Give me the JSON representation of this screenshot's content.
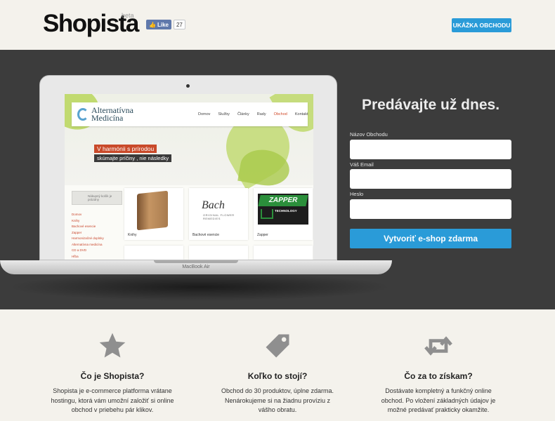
{
  "header": {
    "logo": "Shopista",
    "beta": "beta",
    "like_label": "Like",
    "like_count": "27",
    "demo_button": "UKÁŽKA OBCHODU"
  },
  "laptop": {
    "label": "MacBook Air",
    "site": {
      "name_line1": "Alternatívna",
      "name_line2": "Medicína",
      "nav": [
        "Domov",
        "Služby",
        "Články",
        "Rady",
        "Obchod",
        "Kontakt"
      ],
      "banner_line1": "V harmónii s prírodou",
      "banner_line2": "skúmajte príčiny , nie následky",
      "cart": "Nákupný košík je prázdny",
      "sidebar": [
        "Domov",
        "Knihy",
        "Bachové esencie",
        "Zapper",
        "Harmonizačné doplnky",
        "Alternatívna medicína",
        "CD a DVD",
        "Hľba"
      ],
      "products": [
        "Knihy",
        "Bachové esencie",
        "Zapper"
      ],
      "bach_logo": "Bach",
      "bach_sub": "ORIGINAL FLOWER REMEDIES",
      "zapper_logo": "ZAPPER",
      "zapper_sub": "TECHNOLOGY"
    }
  },
  "form": {
    "title": "Predávajte už dnes.",
    "fields": [
      {
        "label": "Názov Obchodu",
        "value": ""
      },
      {
        "label": "Váš Email",
        "value": ""
      },
      {
        "label": "Heslo",
        "value": ""
      }
    ],
    "submit": "Vytvoriť e-shop zdarma"
  },
  "features": [
    {
      "icon": "star-icon",
      "title": "Čo je Shopista?",
      "text": "Shopista je e-commerce platforma vrátane hostingu, ktorá vám umožní založiť si online obchod v priebehu pár klikov."
    },
    {
      "icon": "price-tag-icon",
      "title": "Koľko to stojí?",
      "text": "Obchod do 30 produktov, úplne zdarma. Nenárokujeme si na žiadnu províziu z vášho obratu."
    },
    {
      "icon": "retweet-icon",
      "title": "Čo za to získam?",
      "text": "Dostávate kompletný a funkčný online obchod. Po vložení základných údajov je možné predávať prakticky okamžite."
    }
  ],
  "colors": {
    "accent": "#2a9bd8",
    "hero_bg": "#3c3c3c",
    "page_bg": "#f4f2ec",
    "icon_gray": "#8f8f8f"
  }
}
